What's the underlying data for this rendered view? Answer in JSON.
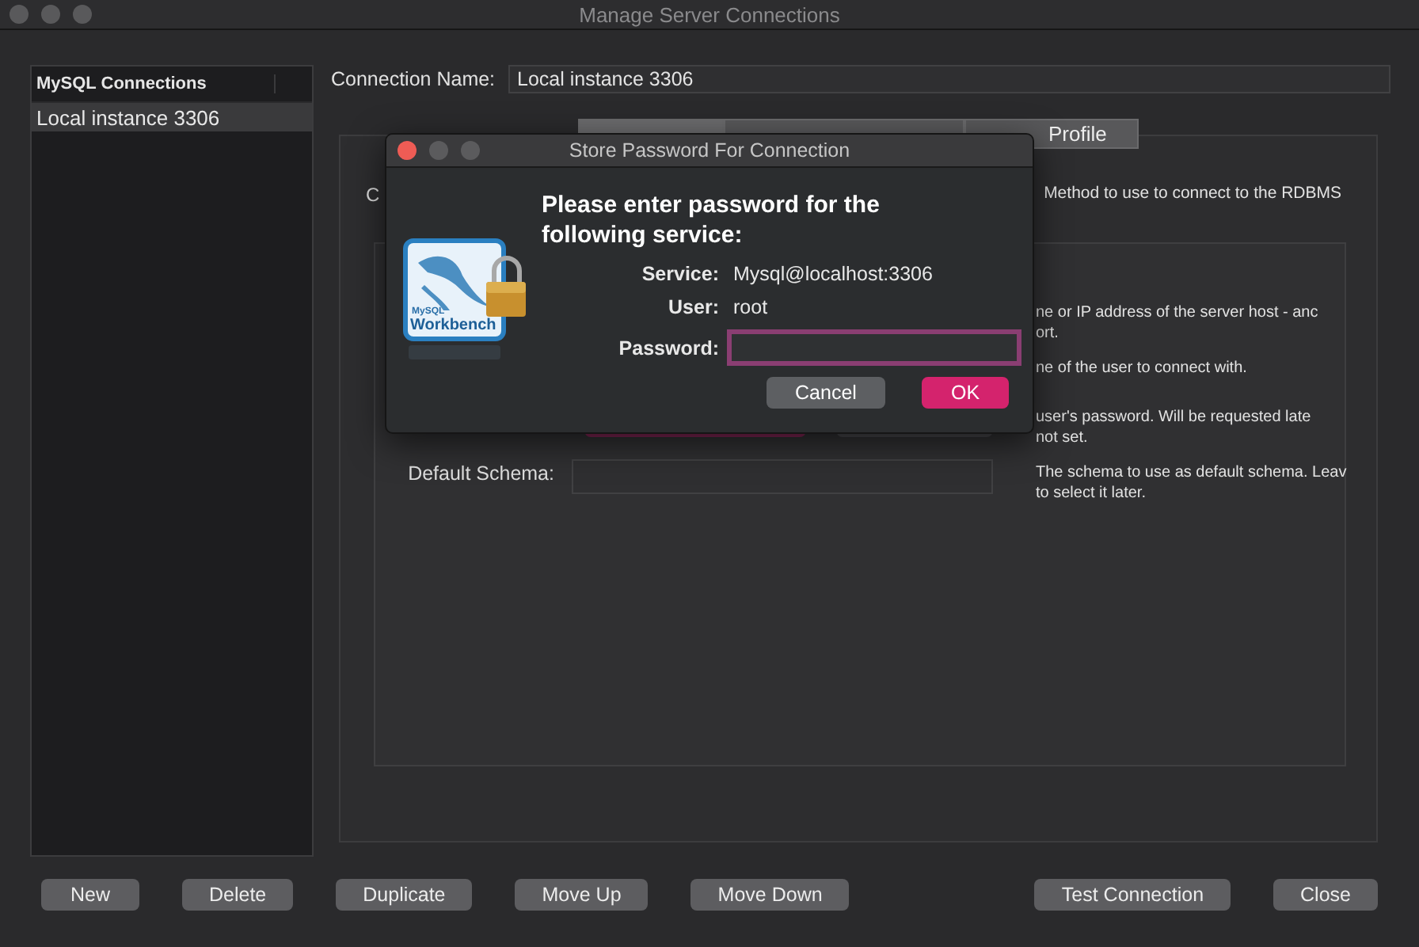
{
  "window": {
    "title": "Manage Server Connections"
  },
  "connections": {
    "header": "MySQL Connections",
    "items": [
      {
        "label": "Local instance 3306",
        "selected": true
      }
    ]
  },
  "connection_name": {
    "label": "Connection Name:",
    "value": "Local instance 3306"
  },
  "tabs": [
    {
      "selected": true
    },
    {
      "selected": false
    },
    {
      "label": "Profile",
      "selected": false
    }
  ],
  "method_row": {
    "label": "C",
    "description": "Method to use to connect to the RDBMS"
  },
  "form_rows": [
    {
      "kind": "plain",
      "description": [
        "ne or IP address of the server host - anc",
        "ort."
      ]
    },
    {
      "kind": "plain",
      "description": [
        "ne of the user to connect with."
      ]
    },
    {
      "kind": "keychain",
      "description": [
        "user's password. Will be requested late",
        "not set."
      ]
    },
    {
      "kind": "field",
      "label": "Default Schema:",
      "description": [
        "The schema to use as default schema. Leav",
        "to select it later."
      ]
    }
  ],
  "dialog": {
    "title": "Store Password For Connection",
    "logo": {
      "brand": "MySQL",
      "product": "Workbench"
    },
    "heading": "Please enter password for the following service:",
    "rows": [
      {
        "label": "Service:",
        "value": "Mysql@localhost:3306"
      },
      {
        "label": "User:",
        "value": "root"
      }
    ],
    "password": {
      "label": "Password:"
    },
    "buttons": [
      {
        "label": "Cancel",
        "kind": "secondary"
      },
      {
        "label": "OK",
        "kind": "primary"
      }
    ]
  },
  "left_buttons": [
    "New",
    "Delete",
    "Duplicate",
    "Move Up",
    "Move Down"
  ],
  "right_buttons": [
    "Test Connection",
    "Close"
  ]
}
